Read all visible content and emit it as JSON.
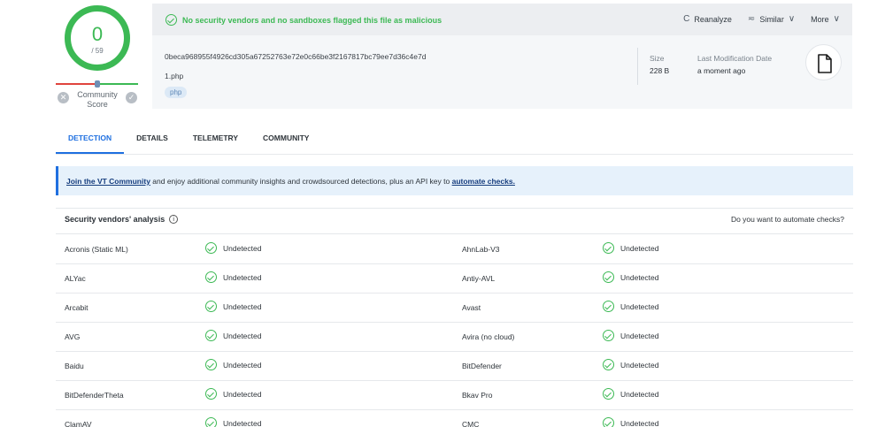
{
  "score": {
    "detections": "0",
    "total": "/ 59",
    "community_label_line1": "Community",
    "community_label_line2": "Score",
    "community_score": 0
  },
  "summary": {
    "flag_text": "No security vendors and no sandboxes flagged this file as malicious",
    "actions": [
      {
        "icon": "reanalyze-icon",
        "glyph": "C",
        "label": "Reanalyze"
      },
      {
        "icon": "similar-icon",
        "glyph": "≂",
        "label": "Similar",
        "chevron": "∨"
      },
      {
        "icon": "more-icon",
        "glyph": "",
        "label": "More",
        "chevron": "∨"
      }
    ],
    "hash": "0beca968955f4926cd305a67252763e72e0c66be3f2167817bc79ee7d36c4e7d",
    "filename": "1.php",
    "tag": "php",
    "size_label": "Size",
    "size_value": "228 B",
    "lastmod_label": "Last Modification Date",
    "lastmod_value": "a moment ago"
  },
  "tabs": [
    "DETECTION",
    "DETAILS",
    "TELEMETRY",
    "COMMUNITY"
  ],
  "banner": {
    "link1": "Join the VT Community",
    "middle": " and enjoy additional community insights and crowdsourced detections, plus an API key to ",
    "link2": "automate checks."
  },
  "vendors": {
    "title": "Security vendors' analysis",
    "info_glyph": "i",
    "question": "Do you want to automate checks?",
    "rows": [
      {
        "left_name": "Acronis (Static ML)",
        "left_result": "Undetected",
        "right_name": "AhnLab-V3",
        "right_result": "Undetected"
      },
      {
        "left_name": "ALYac",
        "left_result": "Undetected",
        "right_name": "Antiy-AVL",
        "right_result": "Undetected"
      },
      {
        "left_name": "Arcabit",
        "left_result": "Undetected",
        "right_name": "Avast",
        "right_result": "Undetected"
      },
      {
        "left_name": "AVG",
        "left_result": "Undetected",
        "right_name": "Avira (no cloud)",
        "right_result": "Undetected"
      },
      {
        "left_name": "Baidu",
        "left_result": "Undetected",
        "right_name": "BitDefender",
        "right_result": "Undetected"
      },
      {
        "left_name": "BitDefenderTheta",
        "left_result": "Undetected",
        "right_name": "Bkav Pro",
        "right_result": "Undetected"
      },
      {
        "left_name": "ClamAV",
        "left_result": "Undetected",
        "right_name": "CMC",
        "right_result": "Undetected"
      }
    ]
  },
  "colors": {
    "clean": "#3cb954",
    "accent": "#1e6fe0",
    "malicious": "#e0443e"
  }
}
